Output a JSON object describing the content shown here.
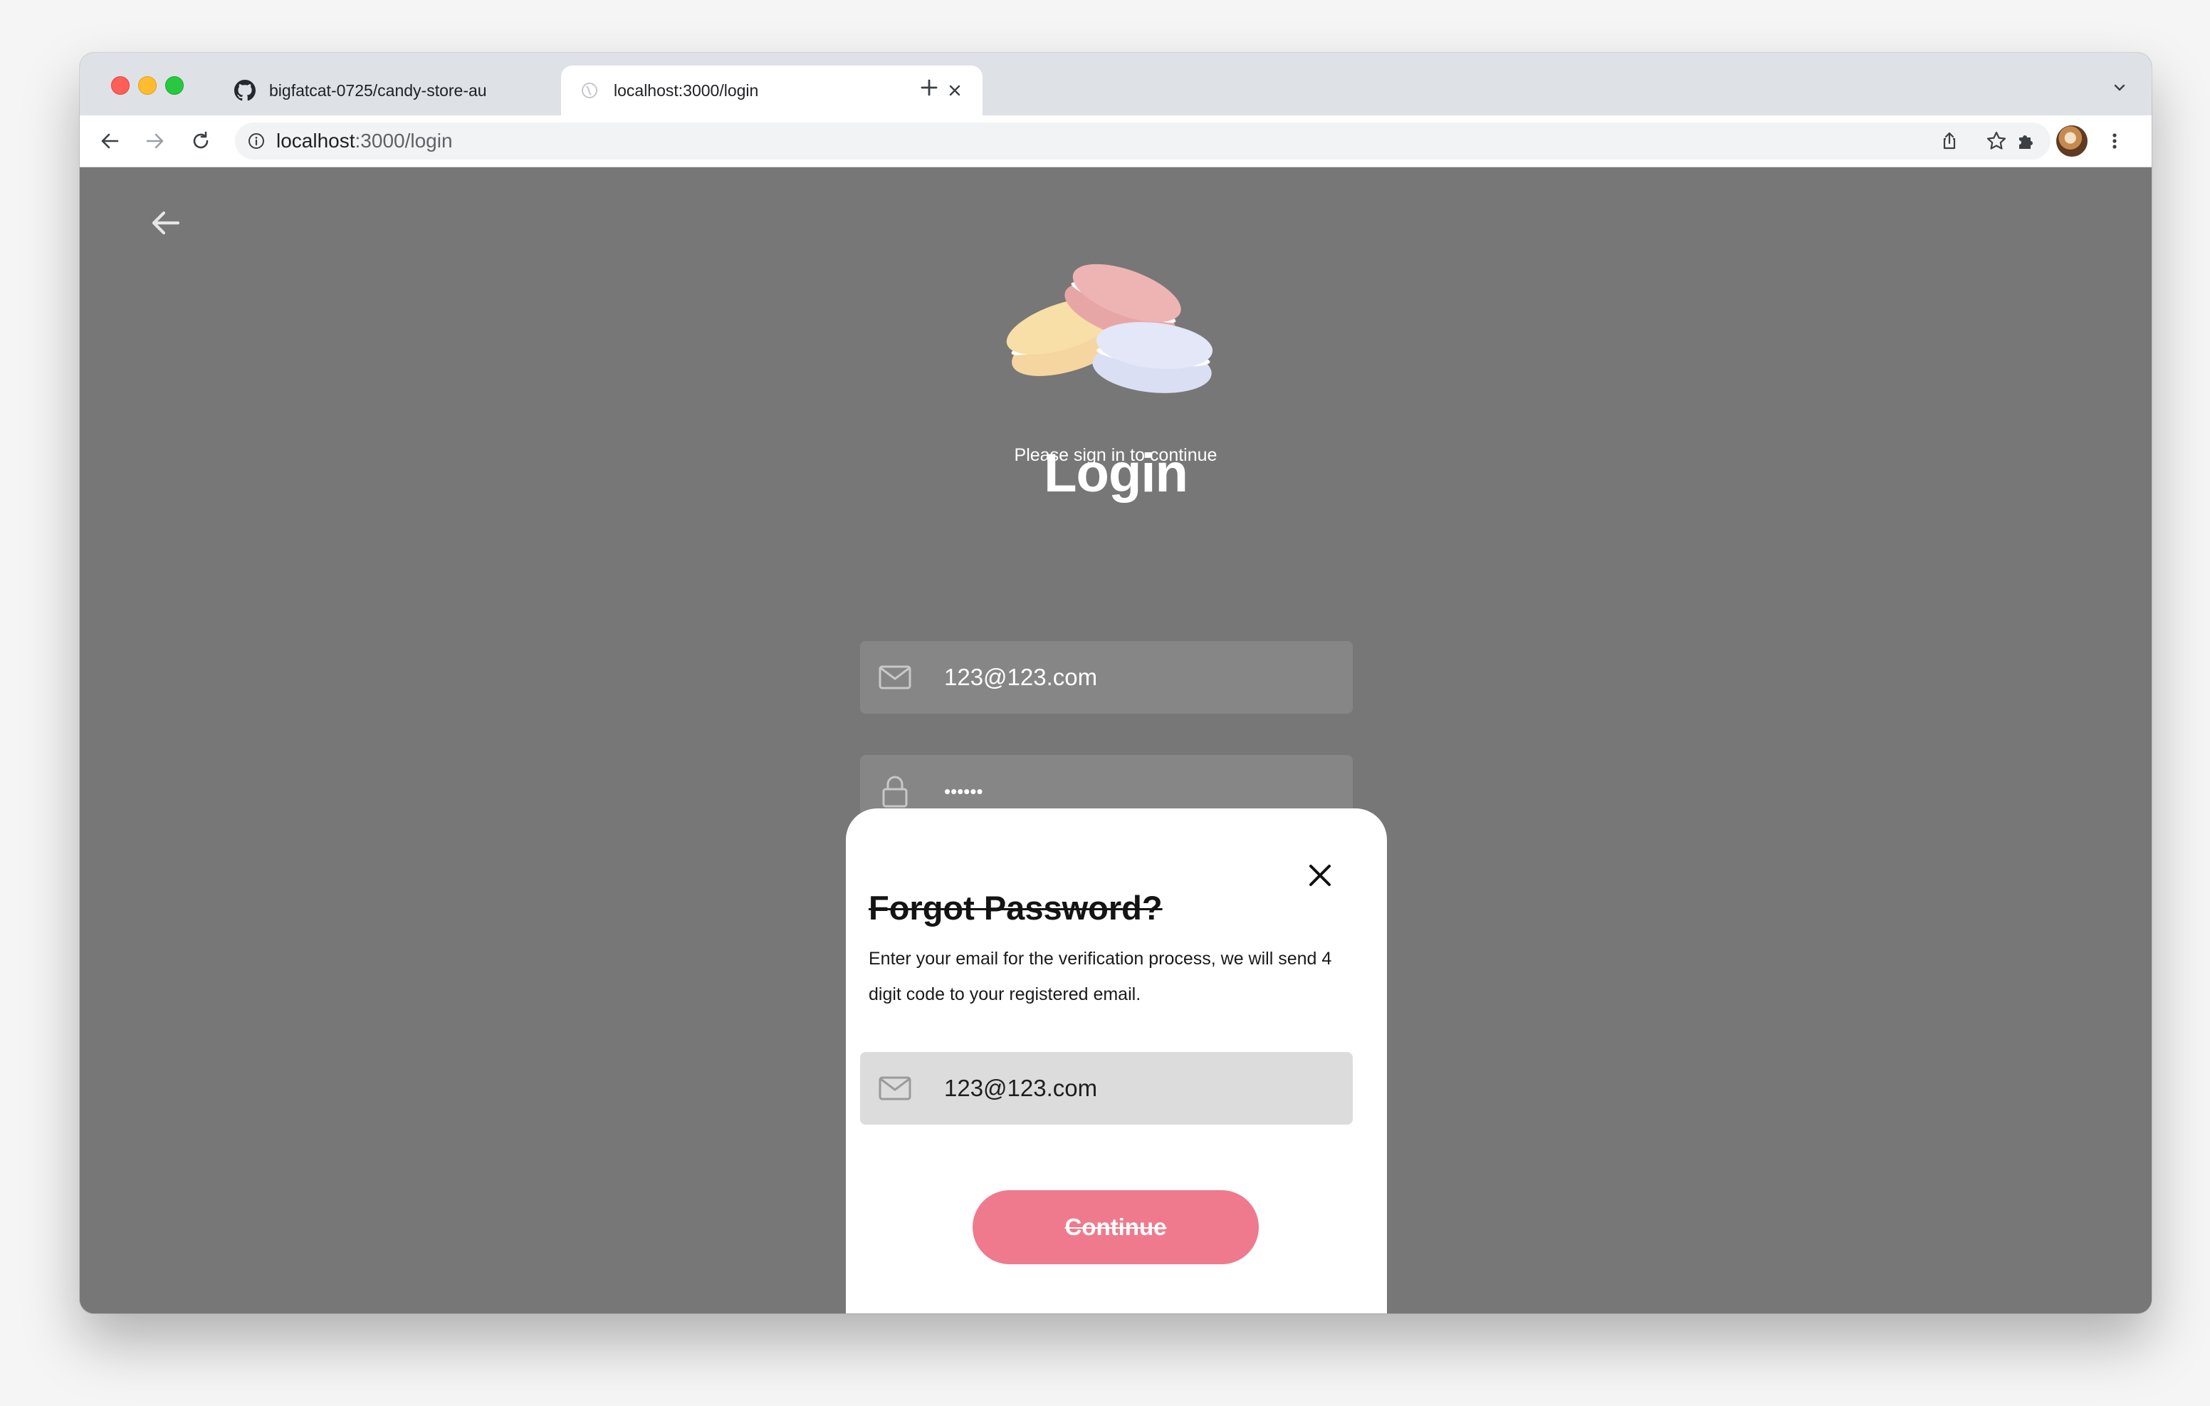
{
  "browser": {
    "tabs": [
      {
        "title": "bigfatcat-0725/candy-store-au",
        "favicon": "github-icon",
        "active": false
      },
      {
        "title": "localhost:3000/login",
        "favicon": "globe-icon",
        "active": true
      }
    ],
    "address_bar": {
      "host": "localhost",
      "path": ":3000/login"
    }
  },
  "page": {
    "title": "Login",
    "subtitle": "Please sign in to continue",
    "email_value": "123@123.com",
    "password_value": "••••••",
    "logo": "macarons-logo"
  },
  "modal": {
    "title": "Forgot Password?",
    "description": "Enter your email for the verification process, we will send 4 digit code to your registered email.",
    "email_value": "123@123.com",
    "continue_label": "Continue"
  },
  "colors": {
    "overlay": "#777777",
    "accent": "#ef7a8d",
    "modal_field": "#dcdcdc",
    "macaron_yellow": "#f8dfa8",
    "macaron_pink": "#eeb4b4",
    "macaron_blue": "#e4e7f7"
  }
}
